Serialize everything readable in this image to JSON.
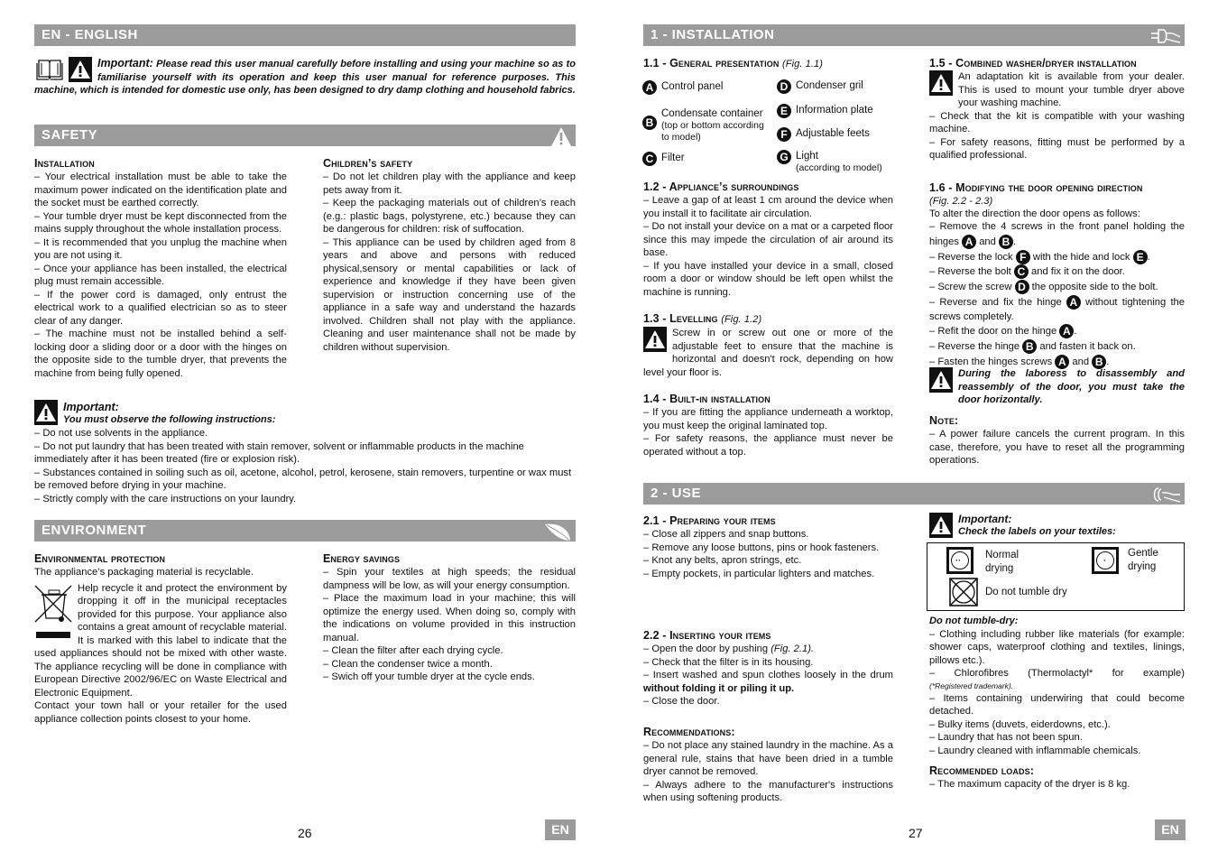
{
  "left_page": {
    "header": "EN - ENGLISH",
    "intro": {
      "lead": "Important:",
      "text": " Please read this user manual carefully before installing and using your machine so as to familiarise yourself with its operation and keep this user manual for reference purposes. This machine, which is intended for domestic use only, has been designed to dry damp clothing and household fabrics."
    },
    "safety": {
      "header": "SAFETY",
      "installation": {
        "title": "Installation",
        "items": [
          "– Your electrical installation must be able to take the maximum power indicated on the identification plate and the socket must be earthed correctly.",
          "– Your tumble dryer must be kept disconnected from the mains supply throughout the whole installation process.",
          "– It is recommended that you unplug the machine when you are not using it.",
          "– Once your appliance has been installed, the electrical plug must remain accessible.",
          "– If the power cord is damaged, only entrust the electrical work to a qualified electrician so as to steer clear of any danger.",
          "– The machine must not be installed behind a self-locking door a sliding door or a door with the hinges on the opposite side to the tumble dryer, that prevents the machine from being fully opened."
        ]
      },
      "children": {
        "title": "Children’s safety",
        "items": [
          "– Do not let children play with the appliance and keep pets away from it.",
          "– Keep the packaging materials out of children’s reach (e.g.: plastic bags, polystyrene, etc.) because they can be dangerous for children: risk of suffocation.",
          "– This appliance can be used by children aged from 8 years and above and persons with reduced physical,sensory or mental capabilities or lack of experience and knowledge if they have been given supervision or instruction concerning use of the appliance in a safe way and understand the hazards involved. Children shall not play with the appliance. Cleaning and user maintenance shall not be made by children without supervision."
        ]
      },
      "important": {
        "title": "Important:",
        "subtitle": "You must observe the following instructions:",
        "items": [
          "– Do not use solvents in the appliance.",
          "– Do not put laundry that has been treated with stain remover, solvent or inflammable products in the machine immediately after it has been treated (fire or explosion risk).",
          "– Substances contained in soiling such as oil, acetone, alcohol, petrol, kerosene, stain removers, turpentine or wax must be removed before drying in your machine.",
          "– Strictly comply with the care instructions on your laundry."
        ]
      }
    },
    "environment": {
      "header": "ENVIRONMENT",
      "protection": {
        "title": "Environmental protection",
        "line1": "The appliance’s packaging material is recyclable.",
        "para": "Help recycle it and protect the environment by dropping it off in the municipal receptacles provided for this purpose. Your appliance also contains a great amount of recyclable material. It is marked with this label to indicate that  the used appliances should not be mixed with other waste. The appliance recycling will be done  in compliance with European Directive 2002/96/EC on Waste Electrical and Electronic Equipment.",
        "contact": "Contact your town hall or your retailer for the used appliance collection points closest to your home."
      },
      "energy": {
        "title": "Energy savings",
        "items": [
          "– Spin your textiles at high speeds; the residual dampness will be low, as will your energy consumption.",
          "– Place the maximum load in your machine; this will optimize the energy used. When doing so, comply with the indications on volume provided in this instruction manual.",
          "– Clean the filter after each drying cycle.",
          "– Clean the condenser twice a month.",
          "– Swich off your tumble dryer at the cycle ends."
        ]
      }
    },
    "page_number": "26",
    "lang_badge": "EN"
  },
  "right_page": {
    "installation": {
      "header": "1 - INSTALLATION",
      "s11": {
        "title": "1.1 - General presentation",
        "fig": "(Fig. 1.1)",
        "legend": [
          {
            "key": "A",
            "label": "Control panel",
            "sub": ""
          },
          {
            "key": "B",
            "label": "Condensate container",
            "sub": "(top or bottom according to model)"
          },
          {
            "key": "C",
            "label": "Filter",
            "sub": ""
          },
          {
            "key": "D",
            "label": "Condenser gril",
            "sub": ""
          },
          {
            "key": "E",
            "label": "Information plate",
            "sub": ""
          },
          {
            "key": "F",
            "label": "Adjustable feets",
            "sub": ""
          },
          {
            "key": "G",
            "label": "Light",
            "sub": "(according to model)"
          }
        ]
      },
      "s12": {
        "title": "1.2 - Appliance’s surroundings",
        "items": [
          "– Leave a gap of at least 1 cm around the device when you install it to facilitate air circulation.",
          "– Do not install your device on a mat or a carpeted floor since this may impede the circulation of air around its base.",
          "– If you have installed your device in a small, closed room a door or window should be left open whilst the machine is running."
        ]
      },
      "s13": {
        "title": "1.3 - Levelling",
        "fig": "(Fig. 1.2)",
        "text": "Screw in or screw out one or more of the adjustable feet to ensure that the machine is horizontal and doesn't rock, depending on how level your floor is."
      },
      "s14": {
        "title": "1.4 - Built-in installation",
        "items": [
          "– If you are fitting the appliance underneath a worktop, you must keep the original laminated top.",
          "– For safety reasons, the appliance must never be operated without a top."
        ]
      },
      "s15": {
        "title": "1.5 - Combined washer/dryer installation",
        "text": "An adaptation kit is available from your dealer. This is used to mount your tumble dryer above your washing machine.",
        "items": [
          "– Check that the kit is compatible with your washing machine.",
          "– For safety reasons, fitting must be performed by a qualified professional."
        ]
      },
      "s16": {
        "title": "1.6 - Modifying the door opening direction",
        "fig": "(Fig. 2.2 - 2.3)",
        "intro": "To alter the direction the door opens as follows:",
        "steps": {
          "s1a": "– Remove the 4 screws in the front panel holding the hinges",
          "and": "and",
          "s2a": "– Reverse the lock",
          "s2b": "with the hide and lock",
          "s3a": "– Reverse the bolt",
          "s3b": "and fix it on the door.",
          "s4a": "– Screw the screw",
          "s4b": "the opposite side to the bolt.",
          "s5a": "– Reverse and fix the hinge",
          "s5b": "without tightening the screws completely.",
          "s6a": "– Refit the door on the hinge",
          "s7a": "– Reverse the hinge",
          "s7b": "and fasten it back on.",
          "s8a": "– Fasten the hinges screws",
          "A": "A",
          "B": "B",
          "C": "C",
          "D": "D",
          "E": "E",
          "F": "F"
        },
        "warning": "During the laboress to disassembly and reassembly of the door, you must take the door horizontally."
      },
      "note": {
        "title": "Note:",
        "text": "– A power failure cancels the current program. In this case, therefore, you have to reset all the programming operations."
      }
    },
    "use": {
      "header": "2 - USE",
      "s21": {
        "title": "2.1 - Preparing your items",
        "items": [
          "– Close all zippers and snap buttons.",
          "– Remove any loose buttons, pins or hook fasteners.",
          "– Knot any belts, apron strings, etc.",
          "– Empty pockets, in particular lighters and matches."
        ]
      },
      "s22": {
        "title": "2.2 - Inserting your items",
        "i1a": "– Open the door by pushing ",
        "i1fig": "(Fig. 2.1).",
        "i2": "– Check that the filter is in its housing.",
        "i3a": "– Insert washed and spun clothes loosely in the drum ",
        "i3b": "without folding it or piling it up.",
        "i4": "– Close the door."
      },
      "recommendations": {
        "title": "Recommendations:",
        "items": [
          "– Do not place any stained laundry in the machine. As a general rule, stains that have been dried in a tumble dryer cannot be removed.",
          "– Always adhere to the manufacturer's instructions when using softening products."
        ]
      },
      "important": {
        "title": "Important:",
        "subtitle": "Check the labels on your textiles:",
        "symbols": [
          {
            "label": "Normal drying"
          },
          {
            "label": "Gentle drying"
          },
          {
            "label": "Do not tumble dry"
          }
        ]
      },
      "do_not": {
        "title": "Do not tumble-dry:",
        "i1": "– Clothing including rubber like materials (for example: shower caps, waterproof clothing and textiles, linings, pillows etc.).",
        "i2": "– Chlorofibres (Thermolactyl* for example)",
        "i2note": "(*Registered trademark).",
        "i3": "– Items containing underwiring that could become detached.",
        "i4": "– Bulky items (duvets, eiderdowns, etc.).",
        "i5": "– Laundry that has not been spun.",
        "i6": "– Laundry cleaned with inflammable chemicals."
      },
      "loads": {
        "title": "Recommended loads:",
        "text": "– The maximum capacity of the dryer is 8 kg."
      }
    },
    "page_number": "27",
    "lang_badge": "EN"
  }
}
